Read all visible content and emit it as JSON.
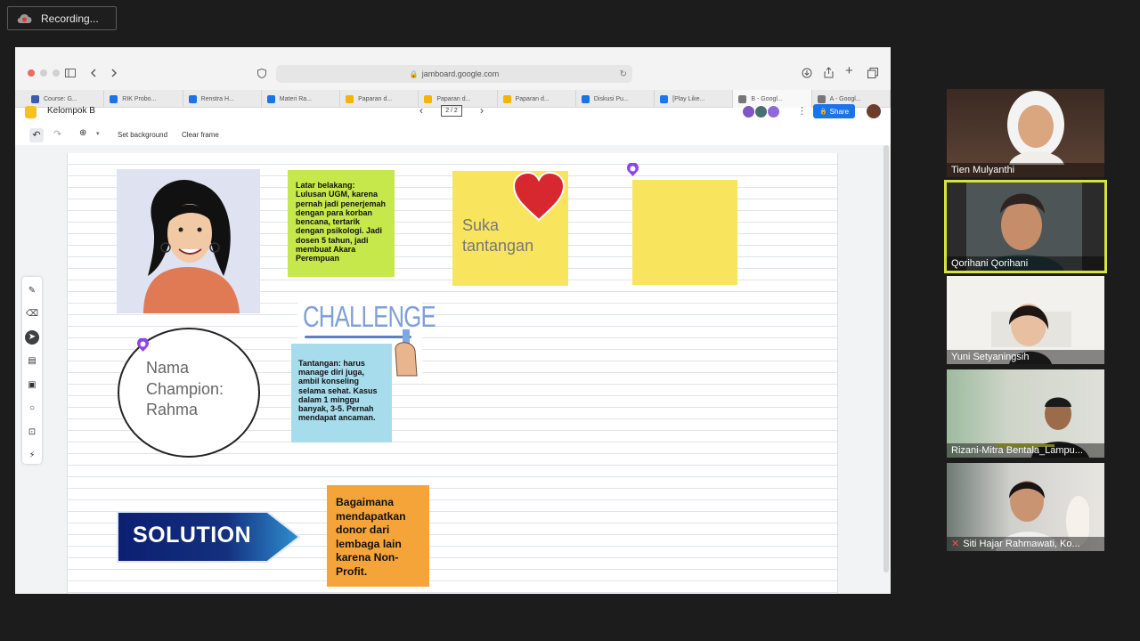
{
  "recording": {
    "label": "Recording..."
  },
  "browser": {
    "url": "jamboard.google.com",
    "tabs": [
      {
        "label": "Course: G...",
        "color": "#3c5bb6"
      },
      {
        "label": "RIK Probo...",
        "color": "#1a73e8"
      },
      {
        "label": "Renstra H...",
        "color": "#1a73e8"
      },
      {
        "label": "Materi Ra...",
        "color": "#1a73e8"
      },
      {
        "label": "Paparan d...",
        "color": "#f4b400"
      },
      {
        "label": "Paparan d...",
        "color": "#f4b400"
      },
      {
        "label": "Paparan d...",
        "color": "#f4b400"
      },
      {
        "label": "Diskusi Pu...",
        "color": "#1a73e8"
      },
      {
        "label": "[Play Like...",
        "color": "#1877f2"
      },
      {
        "label": "B - Googl...",
        "color": "#777777"
      },
      {
        "label": "A - Googl...",
        "color": "#777777"
      }
    ]
  },
  "jamboard": {
    "title": "Kelompok B",
    "page_indicator": "2 / 2",
    "share_label": "Share",
    "toolbar": {
      "set_background": "Set background",
      "clear_frame": "Clear frame"
    }
  },
  "notes": {
    "green": "Latar belakang: Lulusan UGM, karena pernah jadi penerjemah dengan para korban bencana, tertarik dengan psikologi. Jadi dosen 5 tahun, jadi membuat Akara Perempuan",
    "yellow": "Suka tantangan",
    "blue": "Tantangan: harus manage diri juga, ambil konseling selama sehat. Kasus dalam 1 minggu banyak, 3-5. Pernah mendapat ancaman.",
    "orange": "Bagaimana mendapatkan donor dari lembaga lain karena Non-Profit.",
    "circle": "Nama Champion: Rahma",
    "challenge": "CHALLENGE",
    "solution": "SOLUTION"
  },
  "participants": [
    {
      "name": "Tien Mulyanthi"
    },
    {
      "name": "Qorihani Qorihani"
    },
    {
      "name": "Yuni Setyaningsih"
    },
    {
      "name": "Rizani-Mitra Bentala_Lampu..."
    },
    {
      "name": "Siti Hajar Rahmawati, Ko..."
    }
  ]
}
